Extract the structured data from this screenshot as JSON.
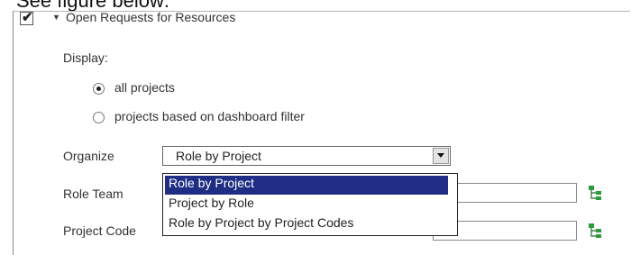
{
  "caption": "See figure below:",
  "section": {
    "checked": true,
    "title": "Open Requests for Resources"
  },
  "display": {
    "label": "Display:",
    "options": [
      {
        "label": "all projects",
        "selected": true
      },
      {
        "label": "projects based on dashboard filter",
        "selected": false
      }
    ]
  },
  "organize": {
    "label": "Organize",
    "selected": "Role by Project",
    "options": [
      "Role by Project",
      "Project by Role",
      "Role by Project by Project Codes"
    ]
  },
  "fields": {
    "role_team_label": "Role Team",
    "project_code_label": "Project Code"
  },
  "icons": {
    "check": "✔",
    "toggle": "▼",
    "tree": "tree-picker-icon"
  },
  "colors": {
    "selection": "#1f2e84",
    "tree_icon": "#2a9a3a"
  }
}
